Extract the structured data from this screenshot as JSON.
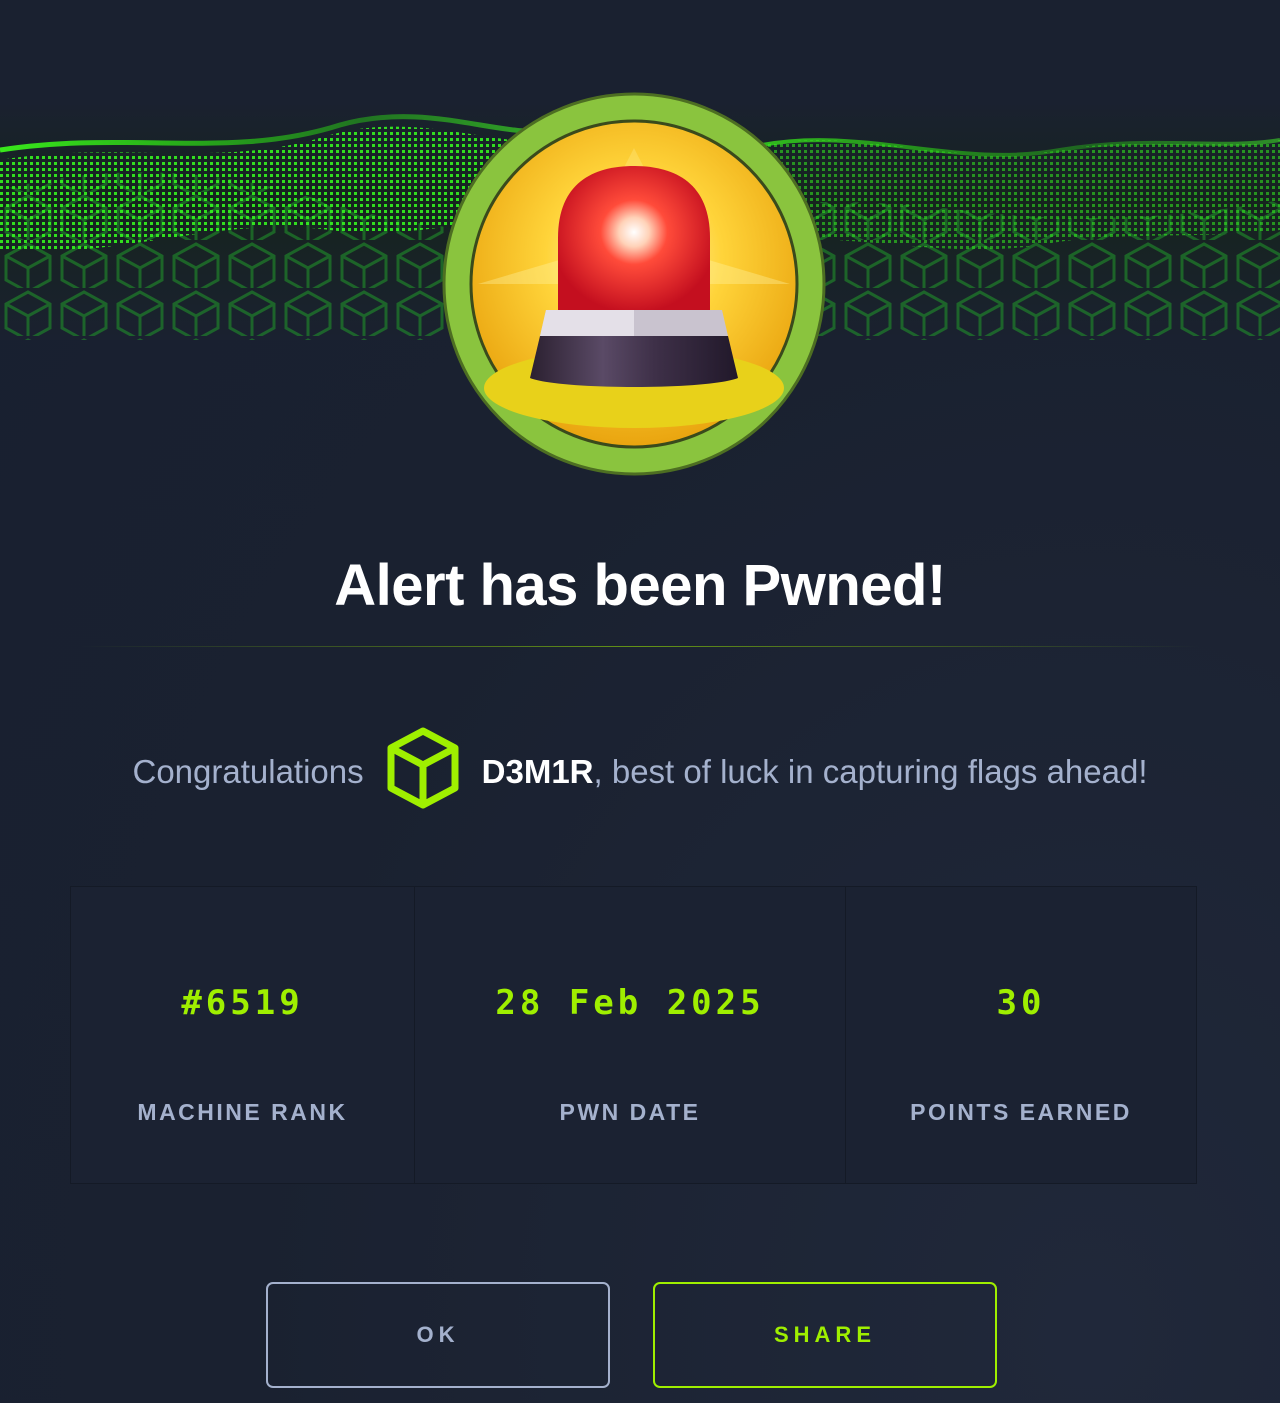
{
  "title": "Alert has been Pwned!",
  "congrats": {
    "prefix": "Congratulations",
    "username": "D3M1R",
    "suffix": ", best of luck in capturing flags ahead!"
  },
  "stats": [
    {
      "value": "#6519",
      "label": "MACHINE RANK"
    },
    {
      "value": "28 Feb 2025",
      "label": "PWN DATE"
    },
    {
      "value": "30",
      "label": "POINTS EARNED"
    }
  ],
  "buttons": {
    "ok": "OK",
    "share": "SHARE"
  },
  "colors": {
    "accent": "#9fef00",
    "background": "#1a2130",
    "muted_text": "#a4b1cd",
    "badge_ring": "#8ac43e"
  },
  "icons": {
    "badge": "siren-icon",
    "user": "cube-icon"
  }
}
